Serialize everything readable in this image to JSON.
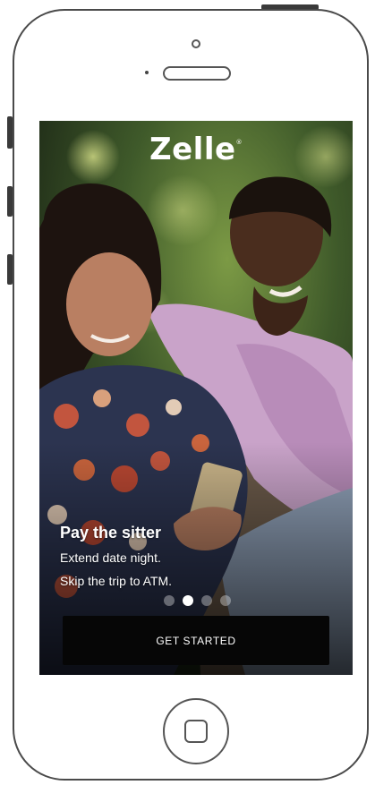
{
  "brand": {
    "name": "Zelle",
    "trademark": "®"
  },
  "onboarding": {
    "headline": "Pay the sitter",
    "lines": [
      "Extend date night.",
      "Skip the trip to ATM."
    ],
    "page_indicator": {
      "count": 4,
      "active": 2
    },
    "cta_label": "GET STARTED"
  },
  "colors": {
    "cta_background": "#060606",
    "text": "#ffffff",
    "frame": "#4a4a4a"
  },
  "icons": {
    "home": "home-button-icon",
    "camera": "front-camera-icon",
    "speaker": "earpiece-speaker-icon"
  }
}
